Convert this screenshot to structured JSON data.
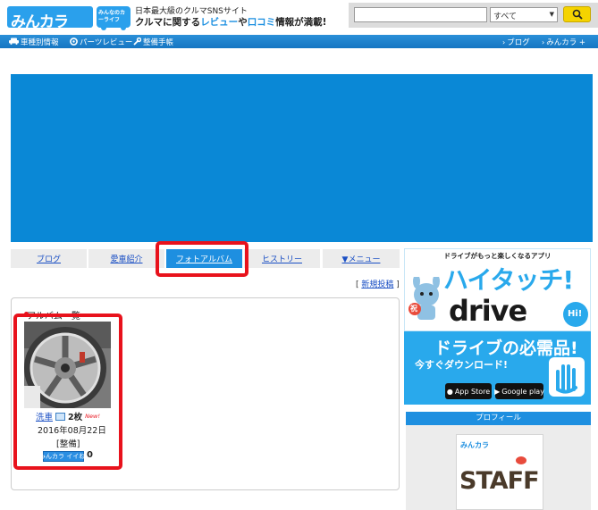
{
  "header": {
    "logo_text": "みんカラ",
    "logo_badge": "みんなのカーライフ",
    "tagline_1": "日本最大級のクルマSNSサイト",
    "tagline_2_a": "クルマに関する",
    "tagline_2_b": "レビュー",
    "tagline_2_c": "や",
    "tagline_2_d": "口コミ",
    "tagline_2_e": "情報が満載!",
    "search": {
      "value": "",
      "select_value": "すべて",
      "button_icon": "search-icon"
    }
  },
  "nav": {
    "left": [
      {
        "label": "車種別情報",
        "icon": "car-icon"
      },
      {
        "label": "パーツレビュー",
        "icon": "gear-icon"
      },
      {
        "label": "整備手帳",
        "icon": "wrench-icon"
      }
    ],
    "right": [
      {
        "label": "ブログ"
      },
      {
        "label": "みんカラ +"
      }
    ]
  },
  "tabs": [
    {
      "label": "ブログ",
      "active": false
    },
    {
      "label": "愛車紹介",
      "active": false
    },
    {
      "label": "フォトアルバム",
      "active": true
    },
    {
      "label": "ヒストリー",
      "active": false
    },
    {
      "label": "▼メニュー",
      "active": false
    }
  ],
  "new_post": {
    "prefix": "[ ",
    "label": "新規投稿",
    "suffix": " ]"
  },
  "album": {
    "title": "アルバム一覧",
    "items": [
      {
        "title": "洗車",
        "count": "2枚",
        "badge": "New!",
        "date": "2016年08月22日",
        "category": "[整備]",
        "iine_label": "みんカラ イイね!",
        "iine_count": "0"
      }
    ]
  },
  "ad": {
    "tagline": "ドライブがもっと楽しくなるアプリ",
    "title": "ハイタッチ!",
    "subtitle": "drive",
    "mascot_badge": "祝",
    "hi_text": "Hi!",
    "mid": "ドライブの必需品!",
    "download": "今すぐダウンロード!",
    "app_store": "App Store",
    "google_play": "Google play"
  },
  "profile": {
    "heading": "プロフィール",
    "logo": "みんカラ",
    "image_text": "STAFF"
  },
  "colors": {
    "brand_blue": "#1e8fe0",
    "highlight_red": "#e8121c",
    "search_yellow": "#f5d300"
  }
}
